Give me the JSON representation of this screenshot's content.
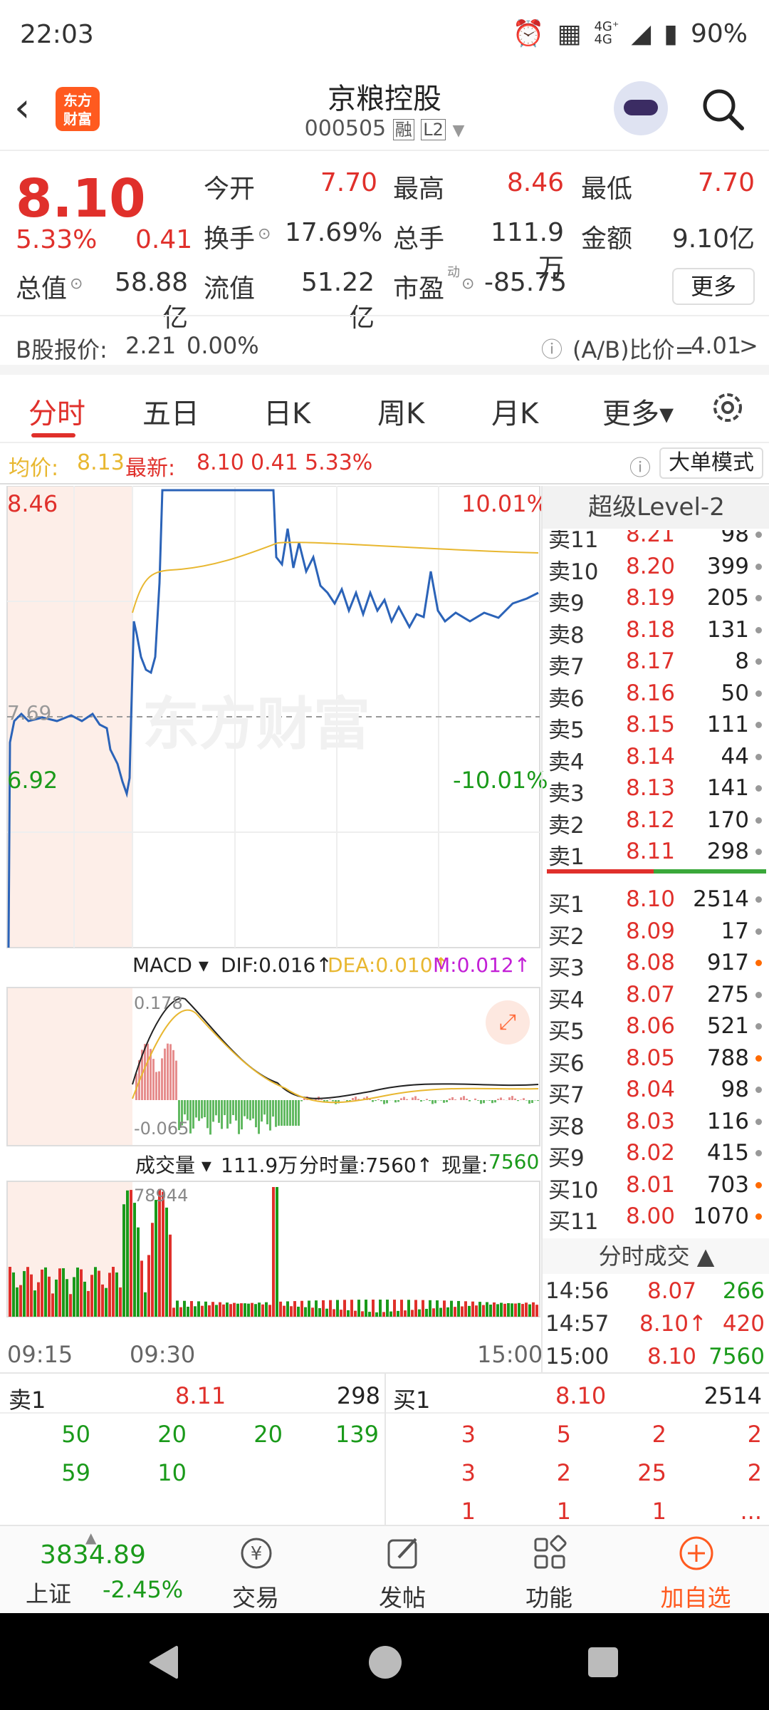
{
  "status_bar": {
    "time": "22:03",
    "network": "4G⁺ 4G",
    "battery": "90%"
  },
  "header": {
    "back": "‹",
    "logo_text": "东方\n财富",
    "name": "京粮控股",
    "code": "000505",
    "badge_rong": "融",
    "badge_l2": "L2"
  },
  "quote": {
    "price": "8.10",
    "pct": "5.33%",
    "change": "0.41",
    "rows": [
      [
        {
          "l": "今开",
          "v": "7.70",
          "c": "red"
        },
        {
          "l": "最高",
          "v": "8.46",
          "c": "red"
        },
        {
          "l": "最低",
          "v": "7.70",
          "c": "red"
        }
      ],
      [
        {
          "l": "换手",
          "v": "17.69%",
          "c": "dark"
        },
        {
          "l": "总手",
          "v": "111.9万",
          "c": "dark"
        },
        {
          "l": "金额",
          "v": "9.10亿",
          "c": "dark"
        }
      ],
      [
        {
          "l": "总值",
          "v": "58.88亿",
          "c": "dark"
        },
        {
          "l": "流值",
          "v": "51.22亿",
          "c": "dark"
        },
        {
          "l": "市盈",
          "v": "-85.75",
          "c": "dark"
        }
      ]
    ],
    "pe_sup": "动",
    "more": "更多",
    "b_label": "B股报价:",
    "b_price": "2.21",
    "b_pct": "0.00%",
    "ab_label": "(A/B)比价=",
    "ab_value": "4.01",
    "ab_arrow": ">"
  },
  "tabs": [
    "分时",
    "五日",
    "日K",
    "周K",
    "月K",
    "更多▾"
  ],
  "avg_line": {
    "avg_label": "均价:",
    "avg": "8.13",
    "latest_label": "最新:",
    "latest": "8.10",
    "chg": "0.41",
    "pct": "5.33%",
    "mode": "大单模式"
  },
  "chart": {
    "high": "8.46",
    "low": "6.92",
    "pre_close": "7.69",
    "up_pct": "10.01%",
    "down_pct": "-10.01%",
    "watermark": "东方财富",
    "macd": {
      "label": "MACD",
      "dif": "DIF:0.016↑",
      "dea": "DEA:0.010↑",
      "m": "M:0.012↑",
      "top": "0.178",
      "bottom": "-0.065"
    },
    "volume": {
      "label": "成交量",
      "total": "111.9万",
      "fsl": "分时量:7560↑",
      "xl_label": "现量:",
      "xl": "7560",
      "max": "78944"
    },
    "times": [
      "09:15",
      "09:30",
      "15:00"
    ]
  },
  "chart_data": {
    "type": "line",
    "x": [
      "09:15",
      "09:30",
      "15:00"
    ],
    "ylim": [
      6.92,
      8.46
    ],
    "series": [],
    "pre_close": 7.69
  },
  "order_book": {
    "title": "超级Level-2",
    "asks": [
      {
        "l": "卖11",
        "p": "8.21",
        "v": "98",
        "o": false
      },
      {
        "l": "卖10",
        "p": "8.20",
        "v": "399",
        "o": false
      },
      {
        "l": "卖9",
        "p": "8.19",
        "v": "205",
        "o": false
      },
      {
        "l": "卖8",
        "p": "8.18",
        "v": "131",
        "o": false
      },
      {
        "l": "卖7",
        "p": "8.17",
        "v": "8",
        "o": false
      },
      {
        "l": "卖6",
        "p": "8.16",
        "v": "50",
        "o": false
      },
      {
        "l": "卖5",
        "p": "8.15",
        "v": "111",
        "o": false
      },
      {
        "l": "卖4",
        "p": "8.14",
        "v": "44",
        "o": false
      },
      {
        "l": "卖3",
        "p": "8.13",
        "v": "141",
        "o": false
      },
      {
        "l": "卖2",
        "p": "8.12",
        "v": "170",
        "o": false
      },
      {
        "l": "卖1",
        "p": "8.11",
        "v": "298",
        "o": false
      }
    ],
    "bids": [
      {
        "l": "买1",
        "p": "8.10",
        "v": "2514",
        "o": false
      },
      {
        "l": "买2",
        "p": "8.09",
        "v": "17",
        "o": false
      },
      {
        "l": "买3",
        "p": "8.08",
        "v": "917",
        "o": true
      },
      {
        "l": "买4",
        "p": "8.07",
        "v": "275",
        "o": false
      },
      {
        "l": "买5",
        "p": "8.06",
        "v": "521",
        "o": false
      },
      {
        "l": "买6",
        "p": "8.05",
        "v": "788",
        "o": true
      },
      {
        "l": "买7",
        "p": "8.04",
        "v": "98",
        "o": false
      },
      {
        "l": "买8",
        "p": "8.03",
        "v": "116",
        "o": false
      },
      {
        "l": "买9",
        "p": "8.02",
        "v": "415",
        "o": false
      },
      {
        "l": "买10",
        "p": "8.01",
        "v": "703",
        "o": true
      },
      {
        "l": "买11",
        "p": "8.00",
        "v": "1070",
        "o": true
      }
    ],
    "trades_title": "分时成交 ▲",
    "trades": [
      {
        "t": "14:56",
        "p": "8.07",
        "v": "266",
        "arrow": ""
      },
      {
        "t": "14:57",
        "p": "8.10",
        "v": "420",
        "arrow": "↑"
      },
      {
        "t": "15:00",
        "p": "8.10",
        "v": "7560",
        "arrow": ""
      }
    ]
  },
  "queue": {
    "sell_label": "卖1",
    "sell_price": "8.11",
    "sell_vol": "298",
    "buy_label": "买1",
    "buy_price": "8.10",
    "buy_vol": "2514",
    "sell_rows": [
      [
        "50",
        "20",
        "20",
        "139"
      ],
      [
        "59",
        "10",
        "",
        ""
      ]
    ],
    "buy_rows": [
      [
        "3",
        "5",
        "2",
        "2"
      ],
      [
        "3",
        "2",
        "25",
        "2"
      ],
      [
        "1",
        "1",
        "1",
        "..."
      ]
    ]
  },
  "tabbar": {
    "index_value": "3834.89",
    "index_name": "上证",
    "index_pct": "-2.45%",
    "items": [
      "交易",
      "发帖",
      "功能",
      "加自选"
    ]
  },
  "colors": {
    "up": "#e0302b",
    "down": "#1a9a1a",
    "accent": "#ff5a1f",
    "price_line": "#2b63b8",
    "avg_line": "#e8b730"
  }
}
